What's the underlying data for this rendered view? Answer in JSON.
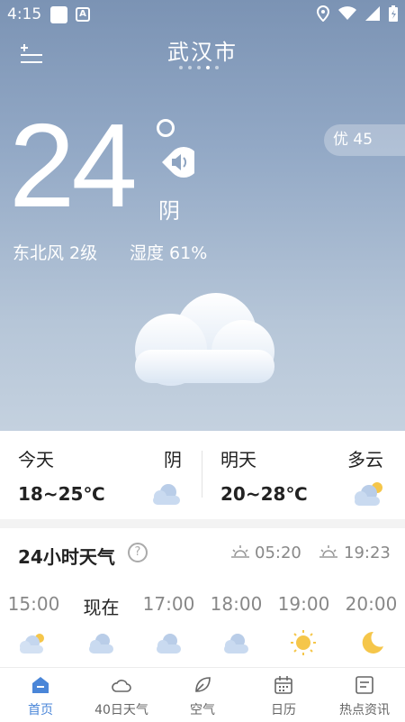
{
  "status_bar": {
    "time": "4:15"
  },
  "header": {
    "city": "武汉市"
  },
  "aqi": {
    "label": "优 45"
  },
  "current": {
    "temp": "24",
    "condition": "阴",
    "wind": "东北风 2级",
    "humidity": "湿度 61%"
  },
  "days": [
    {
      "label": "今天",
      "condition": "阴",
      "range": "18~25℃",
      "icon": "cloud-icon"
    },
    {
      "label": "明天",
      "condition": "多云",
      "range": "20~28℃",
      "icon": "partly-cloudy-icon"
    }
  ],
  "hourly": {
    "title": "24小时天气",
    "sunrise": "05:20",
    "sunset": "19:23",
    "hours": [
      {
        "time": "15:00",
        "icon": "partly-cloudy-icon"
      },
      {
        "time": "现在",
        "icon": "cloud-icon"
      },
      {
        "time": "17:00",
        "icon": "cloud-icon"
      },
      {
        "time": "18:00",
        "icon": "cloud-icon"
      },
      {
        "time": "19:00",
        "icon": "sun-icon"
      },
      {
        "time": "20:00",
        "icon": "moon-icon"
      }
    ]
  },
  "nav": [
    {
      "label": "首页",
      "icon": "home-icon"
    },
    {
      "label": "40日天气",
      "icon": "cloud-outline-icon"
    },
    {
      "label": "空气",
      "icon": "leaf-icon"
    },
    {
      "label": "日历",
      "icon": "calendar-icon"
    },
    {
      "label": "热点资讯",
      "icon": "news-icon"
    }
  ],
  "colors": {
    "accent": "#4a86d8",
    "sky_top": "#7b93b4",
    "sky_bottom": "#c4d1df"
  }
}
